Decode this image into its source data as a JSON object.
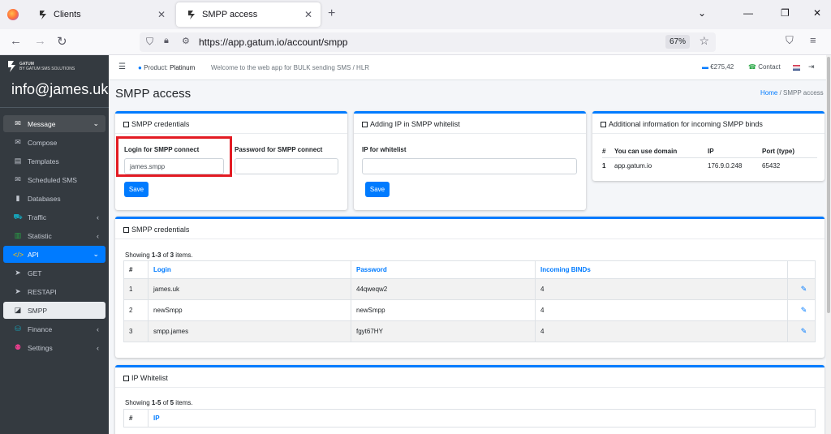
{
  "browser": {
    "tabs": [
      {
        "title": "Clients"
      },
      {
        "title": "SMPP access"
      }
    ],
    "url": "https://app.gatum.io/account/smpp",
    "zoom": "67%"
  },
  "sidebar": {
    "brand": {
      "line1": "GATUM",
      "line2": "BY GATUM SMS SOLUTIONS"
    },
    "user": "info@james.uk",
    "items": [
      {
        "label": "Message",
        "icon": "message-icon",
        "type": "section"
      },
      {
        "label": "Compose",
        "icon": "compose-icon"
      },
      {
        "label": "Templates",
        "icon": "templates-icon"
      },
      {
        "label": "Scheduled SMS",
        "icon": "scheduled-icon"
      },
      {
        "label": "Databases",
        "icon": "database-icon"
      },
      {
        "label": "Traffic",
        "icon": "traffic-icon"
      },
      {
        "label": "Statistic",
        "icon": "statistic-icon"
      },
      {
        "label": "API",
        "icon": "code-icon",
        "type": "active-parent"
      },
      {
        "label": "GET",
        "icon": "send-icon"
      },
      {
        "label": "RESTAPI",
        "icon": "send-icon"
      },
      {
        "label": "SMPP",
        "icon": "smpp-icon",
        "type": "active-child"
      },
      {
        "label": "Finance",
        "icon": "finance-icon"
      },
      {
        "label": "Settings",
        "icon": "settings-icon"
      }
    ]
  },
  "topbar": {
    "product_label": "Product:",
    "product_value": "Platinum",
    "welcome": "Welcome to the web app for BULK sending SMS / HLR",
    "balance": "€275,42",
    "contact": "Contact"
  },
  "page": {
    "title": "SMPP access",
    "breadcrumb_home": "Home",
    "breadcrumb_current": "SMPP access"
  },
  "card_credentials": {
    "title": "SMPP credentials",
    "login_label": "Login for SMPP connect",
    "login_value": "james.smpp",
    "password_label": "Password for SMPP connect",
    "password_value": "",
    "save": "Save"
  },
  "card_whitelist_add": {
    "title": "Adding IP in SMPP whitelist",
    "ip_label": "IP for whitelist",
    "ip_value": "",
    "save": "Save"
  },
  "card_info": {
    "title": "Additional information for incoming SMPP binds",
    "headers": [
      "#",
      "You can use domain",
      "IP",
      "Port (type)"
    ],
    "rows": [
      [
        "1",
        "app.gatum.io",
        "176.9.0.248",
        "65432"
      ]
    ]
  },
  "card_list": {
    "title": "SMPP credentials",
    "showing_prefix": "Showing ",
    "showing_range": "1-3",
    "showing_mid": " of ",
    "showing_total": "3",
    "showing_suffix": " items.",
    "headers": [
      "#",
      "Login",
      "Password",
      "Incoming BINDs"
    ],
    "rows": [
      [
        "1",
        "james.uk",
        "44qweqw2",
        "4"
      ],
      [
        "2",
        "newSmpp",
        "newSmpp",
        "4"
      ],
      [
        "3",
        "smpp.james",
        "fgyt67HY",
        "4"
      ]
    ]
  },
  "card_ip": {
    "title": "IP Whitelist",
    "showing_prefix": "Showing ",
    "showing_range": "1-5",
    "showing_mid": " of ",
    "showing_total": "5",
    "showing_suffix": " items.",
    "headers": [
      "#",
      "IP"
    ]
  }
}
